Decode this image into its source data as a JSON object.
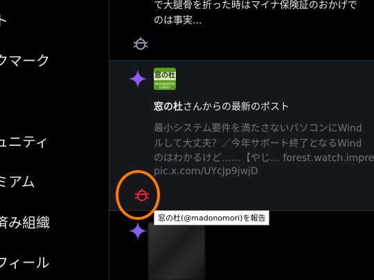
{
  "sidebar": {
    "items": [
      {
        "label": "ト",
        "icon": "notifications"
      },
      {
        "label": "クマーク",
        "icon": "bookmarks"
      },
      {
        "label": "ュニティ",
        "icon": "communities"
      },
      {
        "label": "ミアム",
        "icon": "premium"
      },
      {
        "label": "済み組織",
        "icon": "verified-orgs"
      },
      {
        "label": "フィール",
        "icon": "profile"
      }
    ]
  },
  "feed": {
    "prev_post": {
      "line1": "で大腿骨を折った時はマイナ保険証のおかげで",
      "line2": "のは事実...",
      "icon": "report-bug-icon"
    },
    "main_post": {
      "sparkle_icon": "sparkle-icon",
      "avatar": {
        "text": "窓の杜",
        "sub": "MADONOMORI FOREST"
      },
      "title_bold": "窓の杜",
      "title_rest": "さんからの最新のポスト",
      "body_lines": [
        "最小システム要件を満たさないパソコンにWind",
        "ルして大丈夫？／今年サポート終了となるWind",
        "のはわかるけど……【やじ… forest.watch.impres"
      ],
      "link": "pic.x.com/UYcJp9jwjD",
      "report_icon": "report-bug-icon"
    },
    "tooltip": "窓の杜(@madonomori)を報告",
    "next_post": {
      "sparkle_icon": "sparkle-icon"
    }
  },
  "colors": {
    "background": "#000000",
    "card_hover": "#16181c",
    "divider": "#2f3336",
    "muted_text": "#71767b",
    "sparkle": "#8b5cf6",
    "annotation_ring": "#ff7a00",
    "report_icon_active": "#f4212e"
  }
}
